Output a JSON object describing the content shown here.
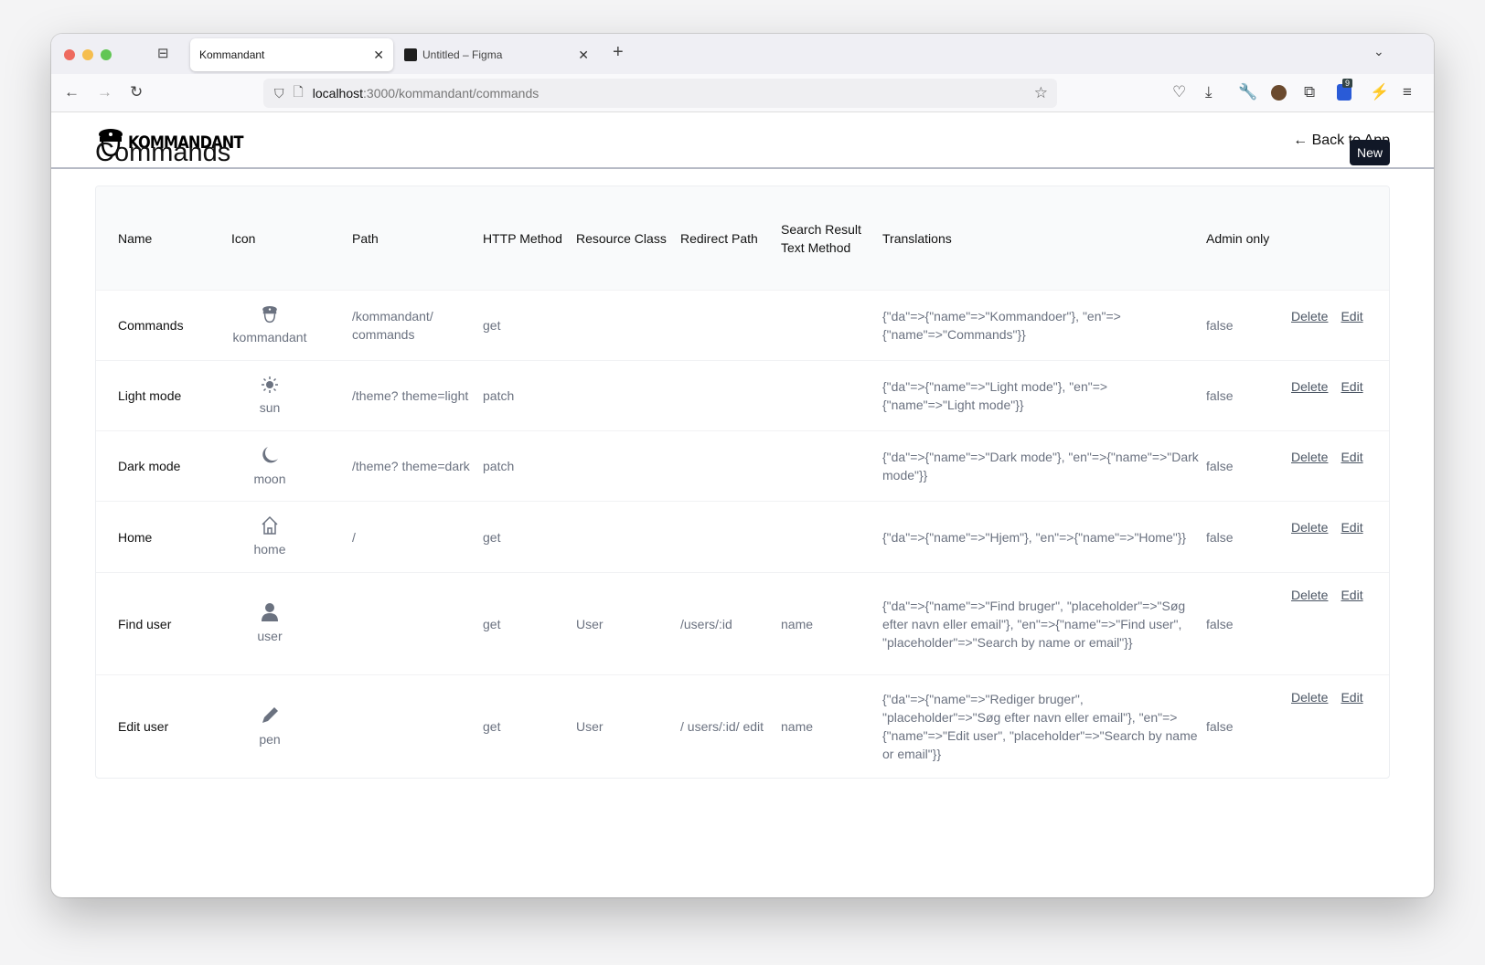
{
  "browser": {
    "tabs": [
      {
        "label": "Kommandant",
        "active": true
      },
      {
        "label": "Untitled – Figma",
        "active": false
      }
    ],
    "url_host": "localhost",
    "url_path": ":3000/kommandant/commands",
    "extension_badge": "9"
  },
  "header": {
    "logo": "KOMMANDANT",
    "back_link": "← Back to App"
  },
  "page": {
    "title": "Commands",
    "new_button": "New"
  },
  "table": {
    "columns": [
      "Name",
      "Icon",
      "Path",
      "HTTP Method",
      "Resource Class",
      "Redirect Path",
      "Search Result Text Method",
      "Translations",
      "Admin only",
      ""
    ],
    "rows": [
      {
        "name": "Commands",
        "icon": "kommandant",
        "path": "/kommandant/ commands",
        "method": "get",
        "resource": "",
        "redirect": "",
        "search": "",
        "translations": "{\"da\"=>{\"name\"=>\"Kommandoer\"}, \"en\"=>{\"name\"=>\"Commands\"}}",
        "admin": "false"
      },
      {
        "name": "Light mode",
        "icon": "sun",
        "path": "/theme? theme=light",
        "method": "patch",
        "resource": "",
        "redirect": "",
        "search": "",
        "translations": "{\"da\"=>{\"name\"=>\"Light mode\"}, \"en\"=>{\"name\"=>\"Light mode\"}}",
        "admin": "false"
      },
      {
        "name": "Dark mode",
        "icon": "moon",
        "path": "/theme? theme=dark",
        "method": "patch",
        "resource": "",
        "redirect": "",
        "search": "",
        "translations": "{\"da\"=>{\"name\"=>\"Dark mode\"}, \"en\"=>{\"name\"=>\"Dark mode\"}}",
        "admin": "false"
      },
      {
        "name": "Home",
        "icon": "home",
        "path": "/",
        "method": "get",
        "resource": "",
        "redirect": "",
        "search": "",
        "translations": "{\"da\"=>{\"name\"=>\"Hjem\"}, \"en\"=>{\"name\"=>\"Home\"}}",
        "admin": "false"
      },
      {
        "name": "Find user",
        "icon": "user",
        "path": "",
        "method": "get",
        "resource": "User",
        "redirect": "/users/:id",
        "search": "name",
        "translations": "{\"da\"=>{\"name\"=>\"Find bruger\", \"placeholder\"=>\"Søg efter navn eller email\"}, \"en\"=>{\"name\"=>\"Find user\", \"placeholder\"=>\"Search by name or email\"}}",
        "admin": "false"
      },
      {
        "name": "Edit user",
        "icon": "pen",
        "path": "",
        "method": "get",
        "resource": "User",
        "redirect": "/ users/:id/ edit",
        "search": "name",
        "translations": "{\"da\"=>{\"name\"=>\"Rediger bruger\", \"placeholder\"=>\"Søg efter navn eller email\"}, \"en\"=>{\"name\"=>\"Edit user\", \"placeholder\"=>\"Search by name or email\"}}",
        "admin": "false"
      }
    ],
    "delete_label": "Delete",
    "edit_label": "Edit"
  },
  "colors": {
    "primary_button": "#111827",
    "muted_text": "#6b7280",
    "header_bg": "#f9fafb"
  }
}
